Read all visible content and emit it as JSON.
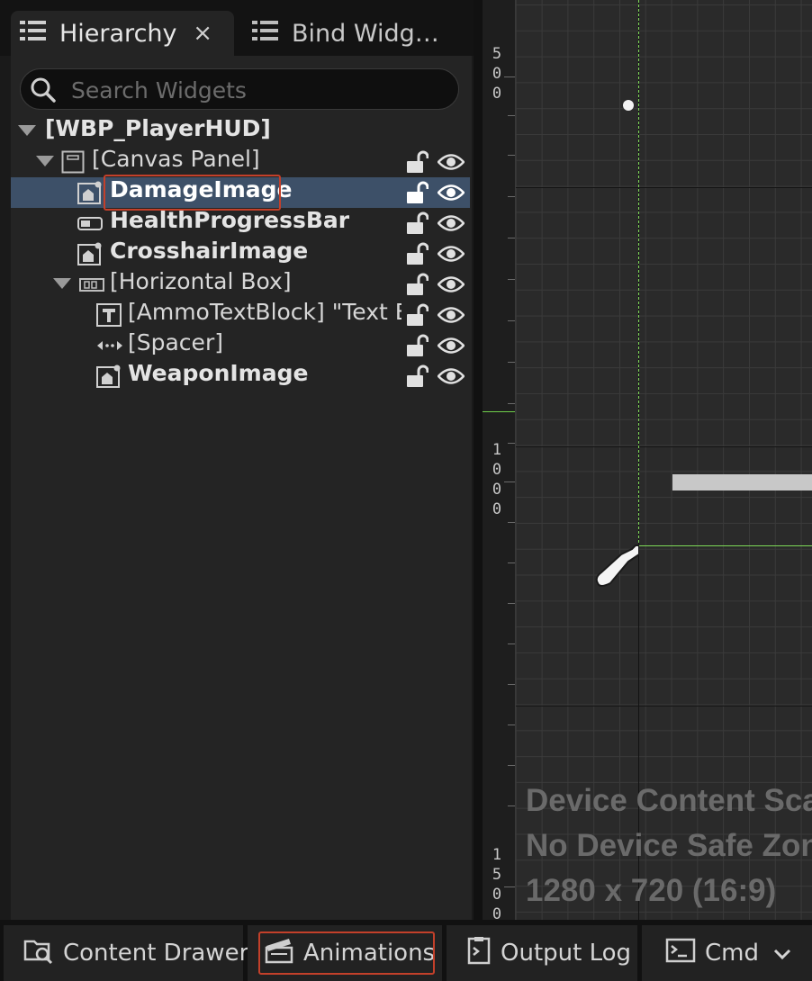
{
  "tabs": {
    "hierarchy": "Hierarchy",
    "hierarchy_close": "×",
    "bind_widgets": "Bind Widg…"
  },
  "search": {
    "placeholder": "Search Widgets"
  },
  "tree": [
    {
      "label": "[WBP_PlayerHUD]",
      "icon": "none",
      "bold": true,
      "expanded": true
    },
    {
      "label": "[Canvas Panel]",
      "icon": "canvas-panel-icon",
      "bold": false,
      "expanded": true
    },
    {
      "label": "DamageImage",
      "icon": "image-icon",
      "bold": true,
      "selected": true
    },
    {
      "label": "HealthProgressBar",
      "icon": "progress-bar-icon",
      "bold": true
    },
    {
      "label": "CrosshairImage",
      "icon": "image-icon",
      "bold": true
    },
    {
      "label": "[Horizontal Box]",
      "icon": "horizontal-box-icon",
      "bold": false,
      "expanded": true
    },
    {
      "label": "[AmmoTextBlock] \"Text B",
      "icon": "text-block-icon",
      "bold": false
    },
    {
      "label": "[Spacer]",
      "icon": "spacer-icon",
      "bold": false
    },
    {
      "label": "WeaponImage",
      "icon": "image-icon",
      "bold": true
    }
  ],
  "ruler": {
    "labels": [
      "500",
      "1000",
      "1500"
    ]
  },
  "canvas_info": {
    "line1": "Device Content Sca",
    "line2": "No Device Safe Zon",
    "line3": "1280 x 720 (16:9)"
  },
  "bottom_bar": {
    "content_drawer": "Content Drawer",
    "animations": "Animations",
    "output_log": "Output Log",
    "cmd": "Cmd"
  },
  "colors": {
    "selection": "#3d5068",
    "highlight_box": "#c3402a",
    "safe_zone": "#7ed957"
  }
}
